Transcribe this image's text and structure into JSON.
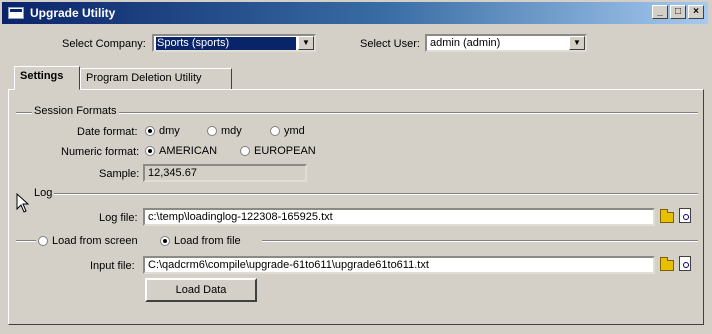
{
  "window": {
    "title": "Upgrade Utility",
    "controls": {
      "minimize": "_",
      "maximize": "□",
      "close": "×"
    }
  },
  "header": {
    "company_label": "Select Company:",
    "company_value": "Sports (sports)",
    "user_label": "Select User:",
    "user_value": "admin (admin)"
  },
  "tabs": [
    {
      "label": "Settings",
      "active": true
    },
    {
      "label": "Program Deletion Utility",
      "active": false
    }
  ],
  "session_formats": {
    "section_label": "Session Formats",
    "date_format_label": "Date format:",
    "date_options": [
      "dmy",
      "mdy",
      "ymd"
    ],
    "date_selected": "dmy",
    "numeric_format_label": "Numeric format:",
    "numeric_options": [
      "AMERICAN",
      "EUROPEAN"
    ],
    "numeric_selected": "AMERICAN",
    "sample_label": "Sample:",
    "sample_value": "12,345.67"
  },
  "log": {
    "section_label": "Log",
    "log_file_label": "Log file:",
    "log_file_value": "c:\\temp\\loadinglog-122308-165925.txt"
  },
  "load": {
    "screen_option": "Load from screen",
    "file_option": "Load from file",
    "selected": "file",
    "input_file_label": "Input file:",
    "input_file_value": "C:\\qadcrm6\\compile\\upgrade-61to611\\upgrade61to611.txt",
    "load_button": "Load Data"
  },
  "icons": {
    "browse": "folder-open-icon",
    "view": "view-file-icon",
    "cursor": "mouse-pointer-icon"
  }
}
